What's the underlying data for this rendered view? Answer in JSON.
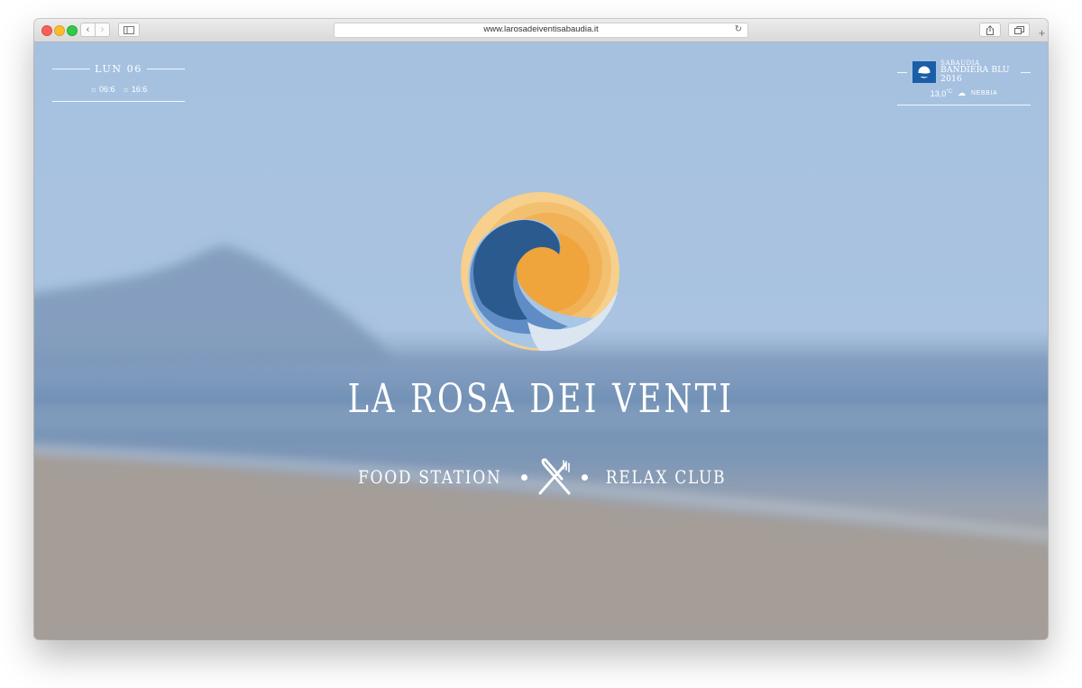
{
  "browser": {
    "url": "www.larosadeiventisabaudia.it",
    "buttons": {
      "back_icon": "chevron-left-icon",
      "forward_icon": "chevron-right-icon",
      "reload_icon": "reload-icon",
      "share_icon": "share-icon",
      "tabs_icon": "tabs-icon",
      "new_tab_icon": "plus-icon"
    }
  },
  "date_widget": {
    "day": "LUN 06",
    "sunrise": "06:6",
    "sunset": "16:6"
  },
  "flag_widget": {
    "line1": "SABAUDIA",
    "line2": "BANDIERA BLU 2016",
    "temperature": "13,0",
    "temp_unit": "°C",
    "weather": "NEBBIA"
  },
  "brand": {
    "title": "LA ROSA DEI VENTI",
    "tag_left": "FOOD STATION",
    "tag_right": "RELAX CLUB"
  },
  "colors": {
    "sky": "#a9c3e0",
    "sea": "#6f8fb4",
    "sand": "#a39c97",
    "logo_orange": "#f0a53a",
    "logo_blue": "#2b5a8f",
    "flag_blue": "#1b5ea8"
  }
}
